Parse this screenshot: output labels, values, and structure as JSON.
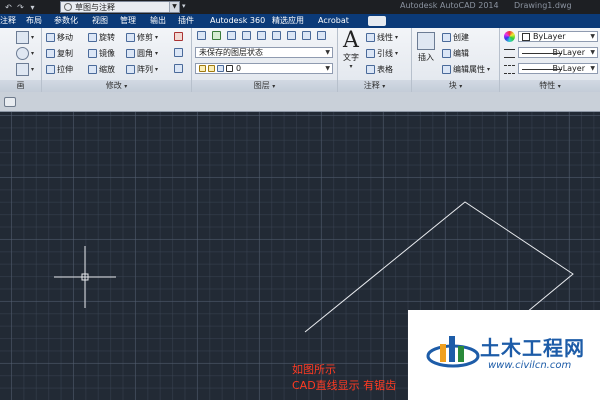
{
  "titlebar": {
    "quick_access_icons": [
      "undo-icon",
      "redo-icon",
      "dropdown-icon"
    ],
    "workspace": "草图与注释",
    "app_title": "Autodesk AutoCAD 2014",
    "doc_title": "Drawing1.dwg"
  },
  "tabs": [
    {
      "id": "annotate-left",
      "label": "注释"
    },
    {
      "id": "layout",
      "label": "布局"
    },
    {
      "id": "parametric",
      "label": "参数化"
    },
    {
      "id": "view",
      "label": "视图"
    },
    {
      "id": "manage",
      "label": "管理"
    },
    {
      "id": "output",
      "label": "输出"
    },
    {
      "id": "plugins",
      "label": "插件"
    },
    {
      "id": "a360",
      "label": "Autodesk 360"
    },
    {
      "id": "featured",
      "label": "精选应用"
    },
    {
      "id": "acrobat",
      "label": "Acrobat"
    }
  ],
  "panels": {
    "draw": {
      "label": "画"
    },
    "modify": {
      "label": "修改",
      "buttons": [
        "移动",
        "旋转",
        "修剪",
        "复制",
        "镜像",
        "圆角",
        "拉伸",
        "缩放",
        "阵列"
      ]
    },
    "layers": {
      "label": "图层",
      "state_combo": "未保存的图层状态",
      "layer_combo": "0"
    },
    "annotation": {
      "label": "注释",
      "text_button": "文字",
      "buttons": [
        "线性",
        "引线",
        "表格"
      ]
    },
    "block": {
      "label": "块",
      "insert_button": "插入",
      "buttons": [
        "创建",
        "编辑",
        "编辑属性"
      ]
    },
    "properties": {
      "label": "特性",
      "color": "ByLayer",
      "linetype": "ByLayer",
      "lineweight": "ByLayer"
    }
  },
  "canvas": {
    "note_line1": "如图所示",
    "note_line2": "CAD直线显示 有锯齿"
  },
  "watermark": {
    "title": "土木工程网",
    "url": "www.civilcn.com"
  },
  "colors": {
    "canvas_bg": "#222a35",
    "ribbon_tab_bg": "#0b3a78",
    "note_red": "#ff3a22",
    "watermark_blue": "#1d5ca8"
  }
}
